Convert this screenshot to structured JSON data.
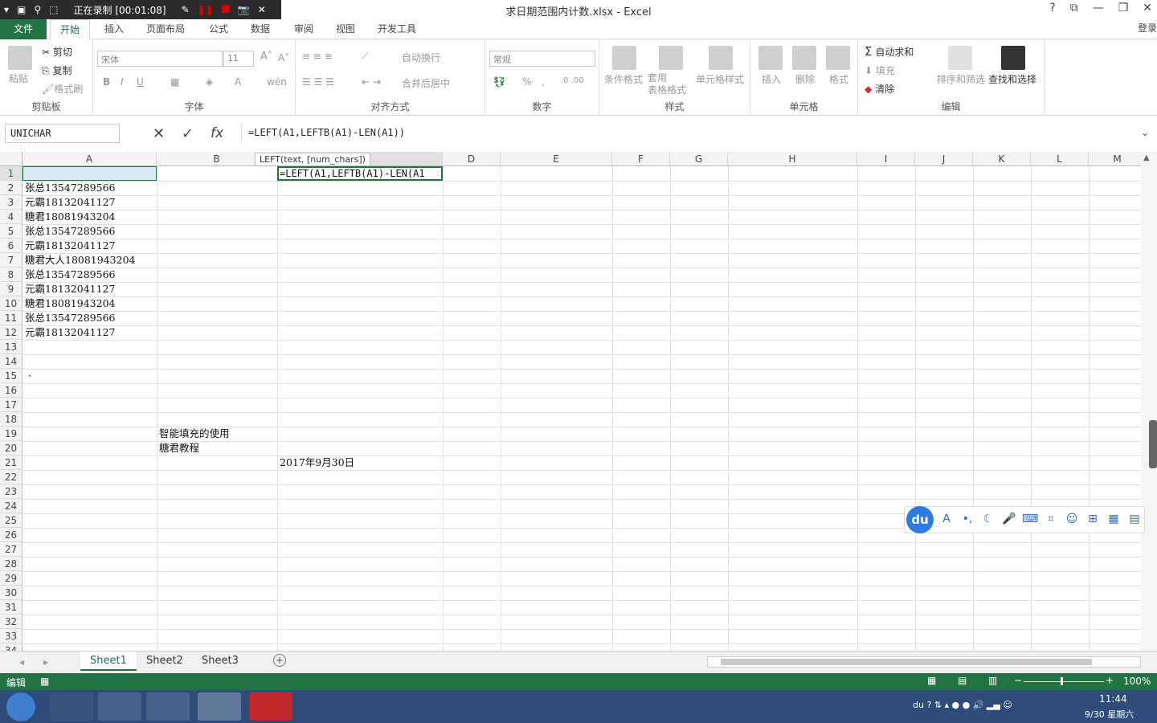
{
  "recorder": {
    "status": "正在录制 [00:01:08]"
  },
  "window": {
    "title": "求日期范围内计数.xlsx - Excel",
    "help": "?",
    "restore_ribbon": "⧉",
    "minimize": "—",
    "maximize": "❐",
    "close": "✕",
    "login": "登录"
  },
  "tabs": [
    "文件",
    "开始",
    "插入",
    "页面布局",
    "公式",
    "数据",
    "审阅",
    "视图",
    "开发工具"
  ],
  "ribbon": {
    "clipboard": {
      "label": "剪贴板",
      "paste": "粘贴",
      "cut": "剪切",
      "copy": "复制",
      "format_painter": "格式刷"
    },
    "font": {
      "label": "字体",
      "font_name": "宋体",
      "font_size": "11",
      "bold": "B",
      "italic": "I",
      "underline": "U"
    },
    "align": {
      "label": "对齐方式",
      "wrap": "自动换行",
      "merge": "合并后居中"
    },
    "number": {
      "label": "数字",
      "format": "常规",
      "percent": "%",
      "comma": ","
    },
    "styles": {
      "label": "样式",
      "cond": "条件格式",
      "table": "套用\n表格格式",
      "cell": "单元格样式"
    },
    "cells": {
      "label": "单元格",
      "insert": "插入",
      "delete": "删除",
      "format": "格式"
    },
    "edit": {
      "label": "编辑",
      "autosum": "自动求和",
      "fill": "填充",
      "clear": "清除",
      "sort": "排序和筛选",
      "find": "查找和选择"
    }
  },
  "formula_bar": {
    "namebox": "UNICHAR",
    "cancel": "✕",
    "enter": "✓",
    "fx": "fx",
    "formula": "=LEFT(A1,LEFTB(A1)-LEN(A1))"
  },
  "tooltip": "LEFT(text, [num_chars])",
  "columns": [
    "A",
    "B",
    "C",
    "D",
    "E",
    "F",
    "G",
    "H",
    "I",
    "J",
    "K",
    "L",
    "M"
  ],
  "rows": [
    "1",
    "2",
    "3",
    "4",
    "5",
    "6",
    "7",
    "8",
    "9",
    "10",
    "11",
    "12",
    "13",
    "14",
    "15",
    "16",
    "17",
    "18",
    "19",
    "20",
    "21",
    "22",
    "23",
    "24",
    "25",
    "26",
    "27",
    "28",
    "29",
    "30",
    "31",
    "32",
    "33",
    "34"
  ],
  "cells": {
    "A": [
      "糖君18081943204",
      "张总13547289566",
      "元霸18132041127",
      "糖君18081943204",
      "张总13547289566",
      "元霸18132041127",
      "糖君大人18081943204",
      "张总13547289566",
      "元霸18132041127",
      "糖君18081943204",
      "张总13547289566",
      "元霸18132041127"
    ],
    "C1": "=LEFT(A1,LEFTB(A1)-LEN(A1",
    "B19": "智能填充的使用",
    "B20": "糖君教程",
    "C21": "2017年9月30日",
    "A15": "·"
  },
  "sheets": [
    "Sheet1",
    "Sheet2",
    "Sheet3"
  ],
  "status": {
    "mode": "编辑",
    "zoom": "100%"
  },
  "taskbar": {
    "time": "11:44",
    "date": "9/30 星期六"
  },
  "ime": {
    "logo": "du"
  }
}
